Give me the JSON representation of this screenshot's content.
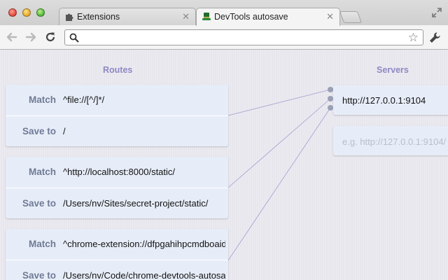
{
  "tabs": [
    {
      "title": "Extensions",
      "icon": "puzzle-icon"
    },
    {
      "title": "DevTools autosave",
      "icon": "hat-icon"
    }
  ],
  "toolbar": {
    "address_value": "",
    "back_icon": "back-arrow-icon",
    "forward_icon": "forward-arrow-icon",
    "reload_icon": "reload-icon",
    "star_icon": "star-icon",
    "wrench_icon": "wrench-icon"
  },
  "routes": {
    "heading": "Routes",
    "match_label": "Match",
    "save_label": "Save to",
    "items": [
      {
        "match": "^file://[^/]*/",
        "save_to": "/"
      },
      {
        "match": "^http://localhost:8000/static/",
        "save_to": "/Users/nv/Sites/secret-project/static/"
      },
      {
        "match": "^chrome-extension://dfpgahihpcmdboaidbfhp",
        "save_to": "/Users/nv/Code/chrome-devtools-autosave"
      }
    ]
  },
  "servers": {
    "heading": "Servers",
    "items": [
      {
        "url": "http://127.0.0.1:9104"
      }
    ],
    "new_placeholder": "e.g. http://127.0.0.1:9104/"
  },
  "colors": {
    "heading": "#8e88c4",
    "label": "#6f7a95",
    "card": "#e7edf8",
    "connector": "#a49fcf"
  }
}
